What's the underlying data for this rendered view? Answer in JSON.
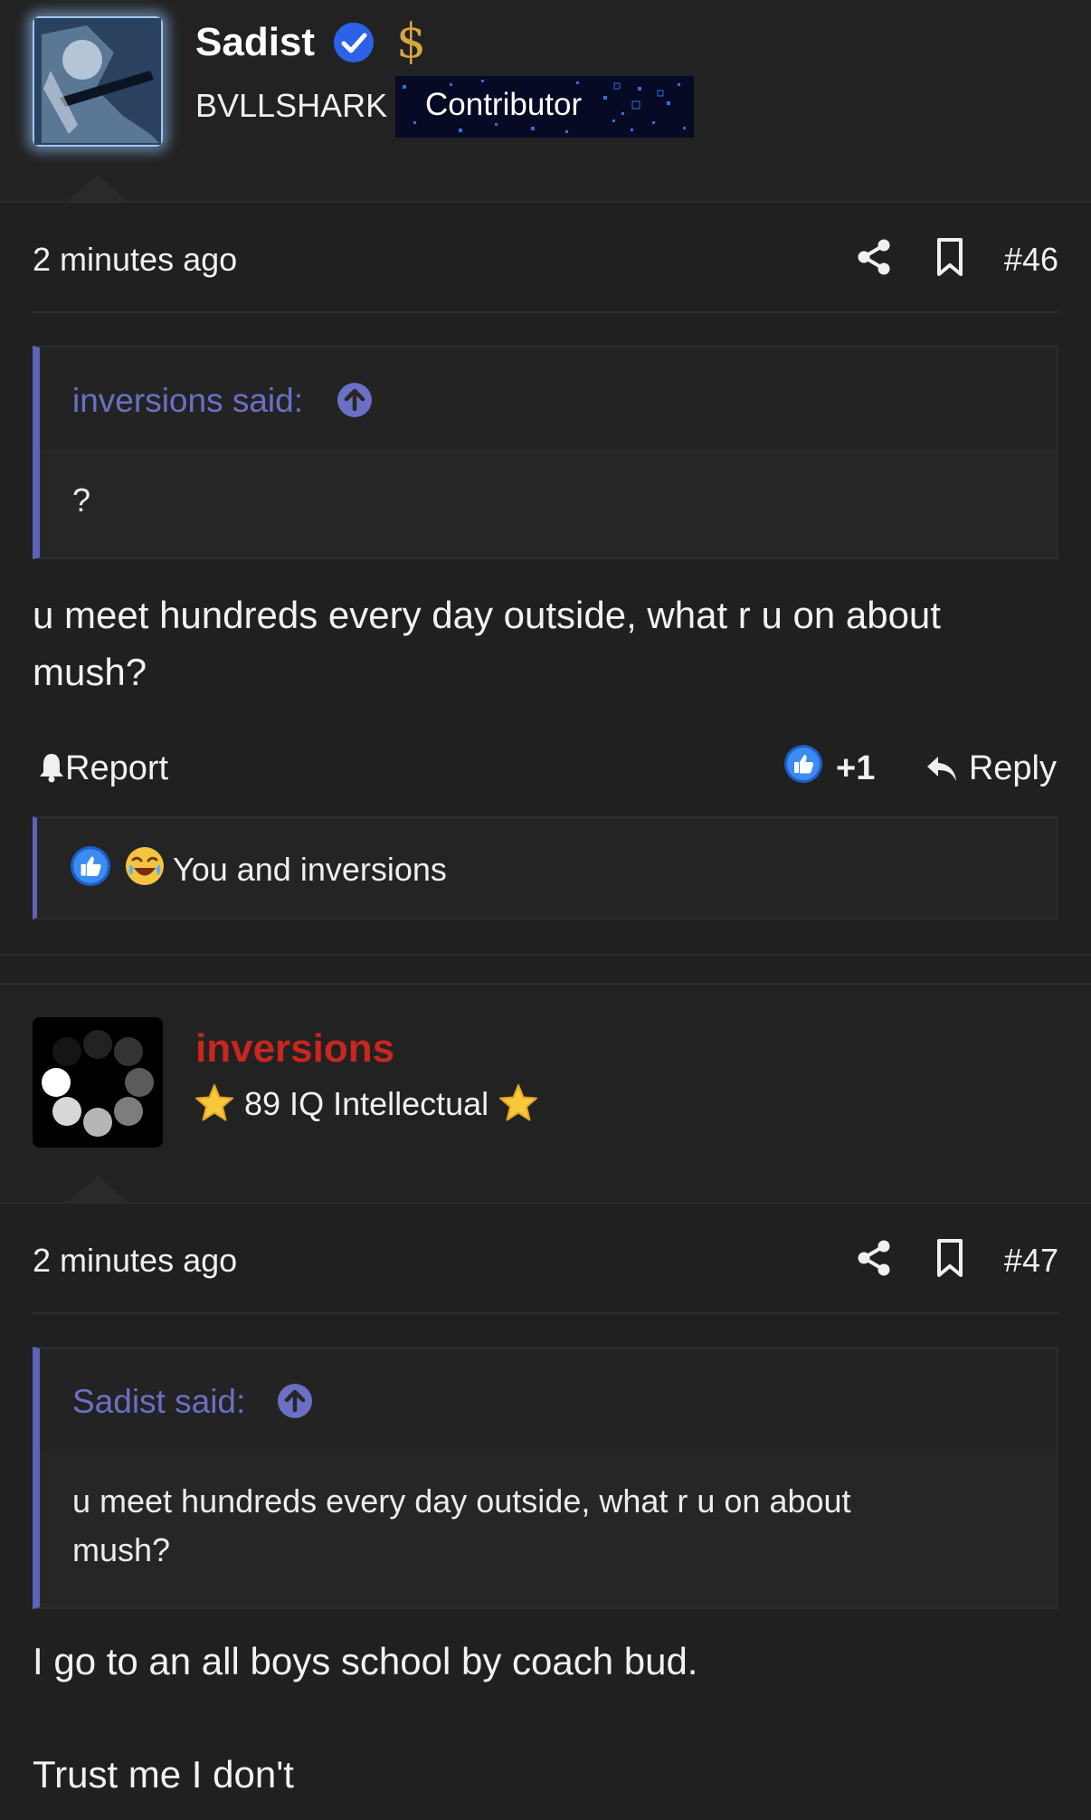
{
  "posts": [
    {
      "author": {
        "name": "Sadist",
        "title": "BVLLSHARK",
        "badge": "Contributor"
      },
      "time": "2 minutes ago",
      "post_number": "#46",
      "quote": {
        "author": "inversions said:",
        "text": "?"
      },
      "body": "u meet hundreds every day outside, what r u on about mush?",
      "actions": {
        "report": "Report",
        "reaction_count": "+1",
        "reply": "Reply"
      },
      "reactions_summary": "You and inversions"
    },
    {
      "author": {
        "name": "inversions",
        "title": "89 IQ Intellectual"
      },
      "time": "2 minutes ago",
      "post_number": "#47",
      "quote": {
        "author": "Sadist said:",
        "text": "u meet hundreds every day outside, what r u on about mush?"
      },
      "body_lines": [
        "I go to an all boys school by coach bud.",
        "Trust me I don't"
      ]
    }
  ],
  "colors": {
    "background": "#202020",
    "quote_accent": "#5d63b8",
    "username_red": "#c8261e",
    "verified_blue": "#2c62e8",
    "dollar_gold": "#d6a640"
  },
  "icons": [
    "verified-icon",
    "dollar-icon",
    "share-icon",
    "bookmark-icon",
    "arrow-up-icon",
    "bell-icon",
    "like-icon",
    "reply-icon",
    "laugh-icon",
    "star-icon"
  ]
}
